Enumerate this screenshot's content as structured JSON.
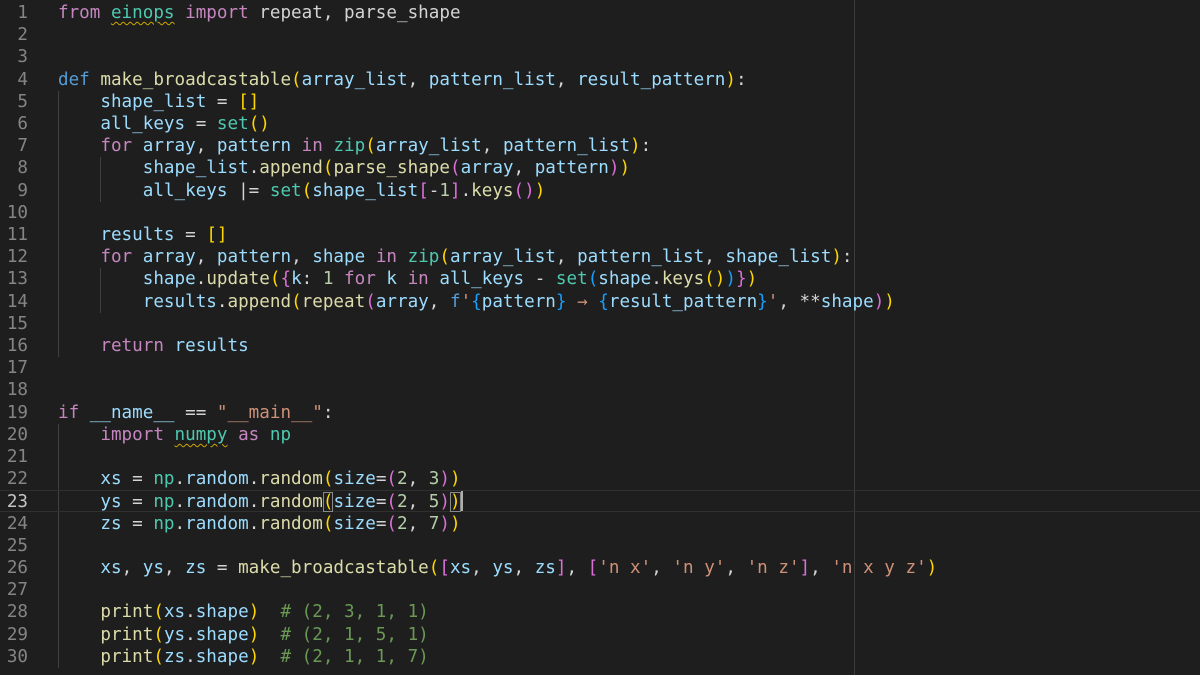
{
  "editor": {
    "language": "python",
    "current_line": 23,
    "lines": [
      {
        "n": "1",
        "tokens": [
          [
            "from",
            "kw"
          ],
          [
            " "
          ],
          [
            "einops",
            "mod",
            "sq"
          ],
          [
            " "
          ],
          [
            "import",
            "kw"
          ],
          [
            " repeat, parse_shape"
          ]
        ]
      },
      {
        "n": "2",
        "tokens": []
      },
      {
        "n": "3",
        "tokens": []
      },
      {
        "n": "4",
        "tokens": [
          [
            "def",
            "def"
          ],
          [
            " "
          ],
          [
            "make_broadcastable",
            "fn"
          ],
          [
            "(",
            "b1"
          ],
          [
            "array_list",
            "var"
          ],
          [
            ", "
          ],
          [
            "pattern_list",
            "var"
          ],
          [
            ", "
          ],
          [
            "result_pattern",
            "var"
          ],
          [
            ")",
            "b1"
          ],
          [
            ":"
          ]
        ]
      },
      {
        "n": "5",
        "tokens": [
          [
            "    "
          ],
          [
            "shape_list",
            "var"
          ],
          [
            " = "
          ],
          [
            "[]",
            "b1"
          ]
        ]
      },
      {
        "n": "6",
        "tokens": [
          [
            "    "
          ],
          [
            "all_keys",
            "var"
          ],
          [
            " = "
          ],
          [
            "set",
            "cls"
          ],
          [
            "()",
            "b1"
          ]
        ]
      },
      {
        "n": "7",
        "tokens": [
          [
            "    "
          ],
          [
            "for",
            "kw"
          ],
          [
            " "
          ],
          [
            "array",
            "var"
          ],
          [
            ", "
          ],
          [
            "pattern",
            "var"
          ],
          [
            " "
          ],
          [
            "in",
            "kw"
          ],
          [
            " "
          ],
          [
            "zip",
            "cls"
          ],
          [
            "(",
            "b1"
          ],
          [
            "array_list",
            "var"
          ],
          [
            ", "
          ],
          [
            "pattern_list",
            "var"
          ],
          [
            ")",
            "b1"
          ],
          [
            ":"
          ]
        ]
      },
      {
        "n": "8",
        "tokens": [
          [
            "        "
          ],
          [
            "shape_list",
            "var"
          ],
          [
            "."
          ],
          [
            "append",
            "fn"
          ],
          [
            "(",
            "b1"
          ],
          [
            "parse_shape",
            "fn"
          ],
          [
            "(",
            "b2"
          ],
          [
            "array",
            "var"
          ],
          [
            ", "
          ],
          [
            "pattern",
            "var"
          ],
          [
            ")",
            "b2"
          ],
          [
            ")",
            "b1"
          ]
        ]
      },
      {
        "n": "9",
        "tokens": [
          [
            "        "
          ],
          [
            "all_keys",
            "var"
          ],
          [
            " |= "
          ],
          [
            "set",
            "cls"
          ],
          [
            "(",
            "b1"
          ],
          [
            "shape_list",
            "var"
          ],
          [
            "[",
            "b2"
          ],
          [
            "-"
          ],
          [
            "1",
            "num"
          ],
          [
            "]",
            "b2"
          ],
          [
            "."
          ],
          [
            "keys",
            "fn"
          ],
          [
            "()",
            "b2"
          ],
          [
            ")",
            "b1"
          ]
        ]
      },
      {
        "n": "10",
        "tokens": []
      },
      {
        "n": "11",
        "tokens": [
          [
            "    "
          ],
          [
            "results",
            "var"
          ],
          [
            " = "
          ],
          [
            "[]",
            "b1"
          ]
        ]
      },
      {
        "n": "12",
        "tokens": [
          [
            "    "
          ],
          [
            "for",
            "kw"
          ],
          [
            " "
          ],
          [
            "array",
            "var"
          ],
          [
            ", "
          ],
          [
            "pattern",
            "var"
          ],
          [
            ", "
          ],
          [
            "shape",
            "var"
          ],
          [
            " "
          ],
          [
            "in",
            "kw"
          ],
          [
            " "
          ],
          [
            "zip",
            "cls"
          ],
          [
            "(",
            "b1"
          ],
          [
            "array_list",
            "var"
          ],
          [
            ", "
          ],
          [
            "pattern_list",
            "var"
          ],
          [
            ", "
          ],
          [
            "shape_list",
            "var"
          ],
          [
            ")",
            "b1"
          ],
          [
            ":"
          ]
        ]
      },
      {
        "n": "13",
        "tokens": [
          [
            "        "
          ],
          [
            "shape",
            "var"
          ],
          [
            "."
          ],
          [
            "update",
            "fn"
          ],
          [
            "(",
            "b1"
          ],
          [
            "{",
            "b2"
          ],
          [
            "k",
            "var"
          ],
          [
            ": "
          ],
          [
            "1",
            "num"
          ],
          [
            " "
          ],
          [
            "for",
            "kw"
          ],
          [
            " "
          ],
          [
            "k",
            "var"
          ],
          [
            " "
          ],
          [
            "in",
            "kw"
          ],
          [
            " "
          ],
          [
            "all_keys",
            "var"
          ],
          [
            " - "
          ],
          [
            "set",
            "cls"
          ],
          [
            "(",
            "b3"
          ],
          [
            "shape",
            "var"
          ],
          [
            "."
          ],
          [
            "keys",
            "fn"
          ],
          [
            "()",
            "b1"
          ],
          [
            ")",
            "b3"
          ],
          [
            "}",
            "b2"
          ],
          [
            ")",
            "b1"
          ]
        ]
      },
      {
        "n": "14",
        "tokens": [
          [
            "        "
          ],
          [
            "results",
            "var"
          ],
          [
            "."
          ],
          [
            "append",
            "fn"
          ],
          [
            "(",
            "b1"
          ],
          [
            "repeat",
            "fn"
          ],
          [
            "(",
            "b2"
          ],
          [
            "array",
            "var"
          ],
          [
            ", "
          ],
          [
            "f",
            "fpre"
          ],
          [
            "'",
            "str"
          ],
          [
            "{",
            "b3"
          ],
          [
            "pattern",
            "var"
          ],
          [
            "}",
            "b3"
          ],
          [
            " → ",
            "str"
          ],
          [
            "{",
            "b3"
          ],
          [
            "result_pattern",
            "var"
          ],
          [
            "}",
            "b3"
          ],
          [
            "'",
            "str"
          ],
          [
            ", "
          ],
          [
            "**"
          ],
          [
            "shape",
            "var"
          ],
          [
            ")",
            "b2"
          ],
          [
            ")",
            "b1"
          ]
        ]
      },
      {
        "n": "15",
        "tokens": []
      },
      {
        "n": "16",
        "tokens": [
          [
            "    "
          ],
          [
            "return",
            "kw"
          ],
          [
            " "
          ],
          [
            "results",
            "var"
          ]
        ]
      },
      {
        "n": "17",
        "tokens": []
      },
      {
        "n": "18",
        "tokens": []
      },
      {
        "n": "19",
        "tokens": [
          [
            "if",
            "kw"
          ],
          [
            " "
          ],
          [
            "__name__",
            "var"
          ],
          [
            " == "
          ],
          [
            "\"__main__\"",
            "str"
          ],
          [
            ":"
          ]
        ]
      },
      {
        "n": "20",
        "tokens": [
          [
            "    "
          ],
          [
            "import",
            "kw"
          ],
          [
            " "
          ],
          [
            "numpy",
            "mod",
            "sq"
          ],
          [
            " "
          ],
          [
            "as",
            "kw"
          ],
          [
            " "
          ],
          [
            "np",
            "mod"
          ]
        ]
      },
      {
        "n": "21",
        "tokens": []
      },
      {
        "n": "22",
        "tokens": [
          [
            "    "
          ],
          [
            "xs",
            "var"
          ],
          [
            " = "
          ],
          [
            "np",
            "mod"
          ],
          [
            "."
          ],
          [
            "random",
            "var"
          ],
          [
            "."
          ],
          [
            "random",
            "fn"
          ],
          [
            "(",
            "b1"
          ],
          [
            "size",
            "var"
          ],
          [
            "="
          ],
          [
            "(",
            "b2"
          ],
          [
            "2",
            "num"
          ],
          [
            ", "
          ],
          [
            "3",
            "num"
          ],
          [
            ")",
            "b2"
          ],
          [
            ")",
            "b1"
          ]
        ]
      },
      {
        "n": "23",
        "tokens": [
          [
            "    "
          ],
          [
            "ys",
            "var"
          ],
          [
            " = "
          ],
          [
            "np",
            "mod"
          ],
          [
            "."
          ],
          [
            "random",
            "var"
          ],
          [
            "."
          ],
          [
            "random",
            "fn"
          ],
          [
            "(",
            "b1",
            "bm"
          ],
          [
            "size",
            "var"
          ],
          [
            "="
          ],
          [
            "(",
            "b2"
          ],
          [
            "2",
            "num"
          ],
          [
            ", "
          ],
          [
            "5",
            "num"
          ],
          [
            ")",
            "b2"
          ],
          [
            ")",
            "b1",
            "bm"
          ]
        ]
      },
      {
        "n": "24",
        "tokens": [
          [
            "    "
          ],
          [
            "zs",
            "var"
          ],
          [
            " = "
          ],
          [
            "np",
            "mod"
          ],
          [
            "."
          ],
          [
            "random",
            "var"
          ],
          [
            "."
          ],
          [
            "random",
            "fn"
          ],
          [
            "(",
            "b1"
          ],
          [
            "size",
            "var"
          ],
          [
            "="
          ],
          [
            "(",
            "b2"
          ],
          [
            "2",
            "num"
          ],
          [
            ", "
          ],
          [
            "7",
            "num"
          ],
          [
            ")",
            "b2"
          ],
          [
            ")",
            "b1"
          ]
        ]
      },
      {
        "n": "25",
        "tokens": []
      },
      {
        "n": "26",
        "tokens": [
          [
            "    "
          ],
          [
            "xs",
            "var"
          ],
          [
            ", "
          ],
          [
            "ys",
            "var"
          ],
          [
            ", "
          ],
          [
            "zs",
            "var"
          ],
          [
            " = "
          ],
          [
            "make_broadcastable",
            "fn"
          ],
          [
            "(",
            "b1"
          ],
          [
            "[",
            "b2"
          ],
          [
            "xs",
            "var"
          ],
          [
            ", "
          ],
          [
            "ys",
            "var"
          ],
          [
            ", "
          ],
          [
            "zs",
            "var"
          ],
          [
            "]",
            "b2"
          ],
          [
            ", "
          ],
          [
            "[",
            "b2"
          ],
          [
            "'n x'",
            "str"
          ],
          [
            ", "
          ],
          [
            "'n y'",
            "str"
          ],
          [
            ", "
          ],
          [
            "'n z'",
            "str"
          ],
          [
            "]",
            "b2"
          ],
          [
            ", "
          ],
          [
            "'n x y z'",
            "str"
          ],
          [
            ")",
            "b1"
          ]
        ]
      },
      {
        "n": "27",
        "tokens": []
      },
      {
        "n": "28",
        "tokens": [
          [
            "    "
          ],
          [
            "print",
            "fn"
          ],
          [
            "(",
            "b1"
          ],
          [
            "xs",
            "var"
          ],
          [
            "."
          ],
          [
            "shape",
            "var"
          ],
          [
            ")",
            "b1"
          ],
          [
            "  "
          ],
          [
            "# (2, 3, 1, 1)",
            "cmt"
          ]
        ]
      },
      {
        "n": "29",
        "tokens": [
          [
            "    "
          ],
          [
            "print",
            "fn"
          ],
          [
            "(",
            "b1"
          ],
          [
            "ys",
            "var"
          ],
          [
            "."
          ],
          [
            "shape",
            "var"
          ],
          [
            ")",
            "b1"
          ],
          [
            "  "
          ],
          [
            "# (2, 1, 5, 1)",
            "cmt"
          ]
        ]
      },
      {
        "n": "30",
        "tokens": [
          [
            "    "
          ],
          [
            "print",
            "fn"
          ],
          [
            "(",
            "b1"
          ],
          [
            "zs",
            "var"
          ],
          [
            "."
          ],
          [
            "shape",
            "var"
          ],
          [
            ")",
            "b1"
          ],
          [
            "  "
          ],
          [
            "# (2, 1, 1, 7)",
            "cmt"
          ]
        ]
      }
    ]
  },
  "colors": {
    "background": "#1e1e1e",
    "kw": "#c586c0",
    "def": "#569cd6",
    "fn": "#dcdcaa",
    "var": "#9cdcfe",
    "cls": "#4ec9b0",
    "mod": "#4ec9b0",
    "num": "#b5cea8",
    "str": "#ce9178",
    "fpre": "#569cd6",
    "cmt": "#6a9955",
    "b1": "#ffd700",
    "b2": "#da70d6",
    "b3": "#179fff",
    "plain": "#d4d4d4"
  }
}
